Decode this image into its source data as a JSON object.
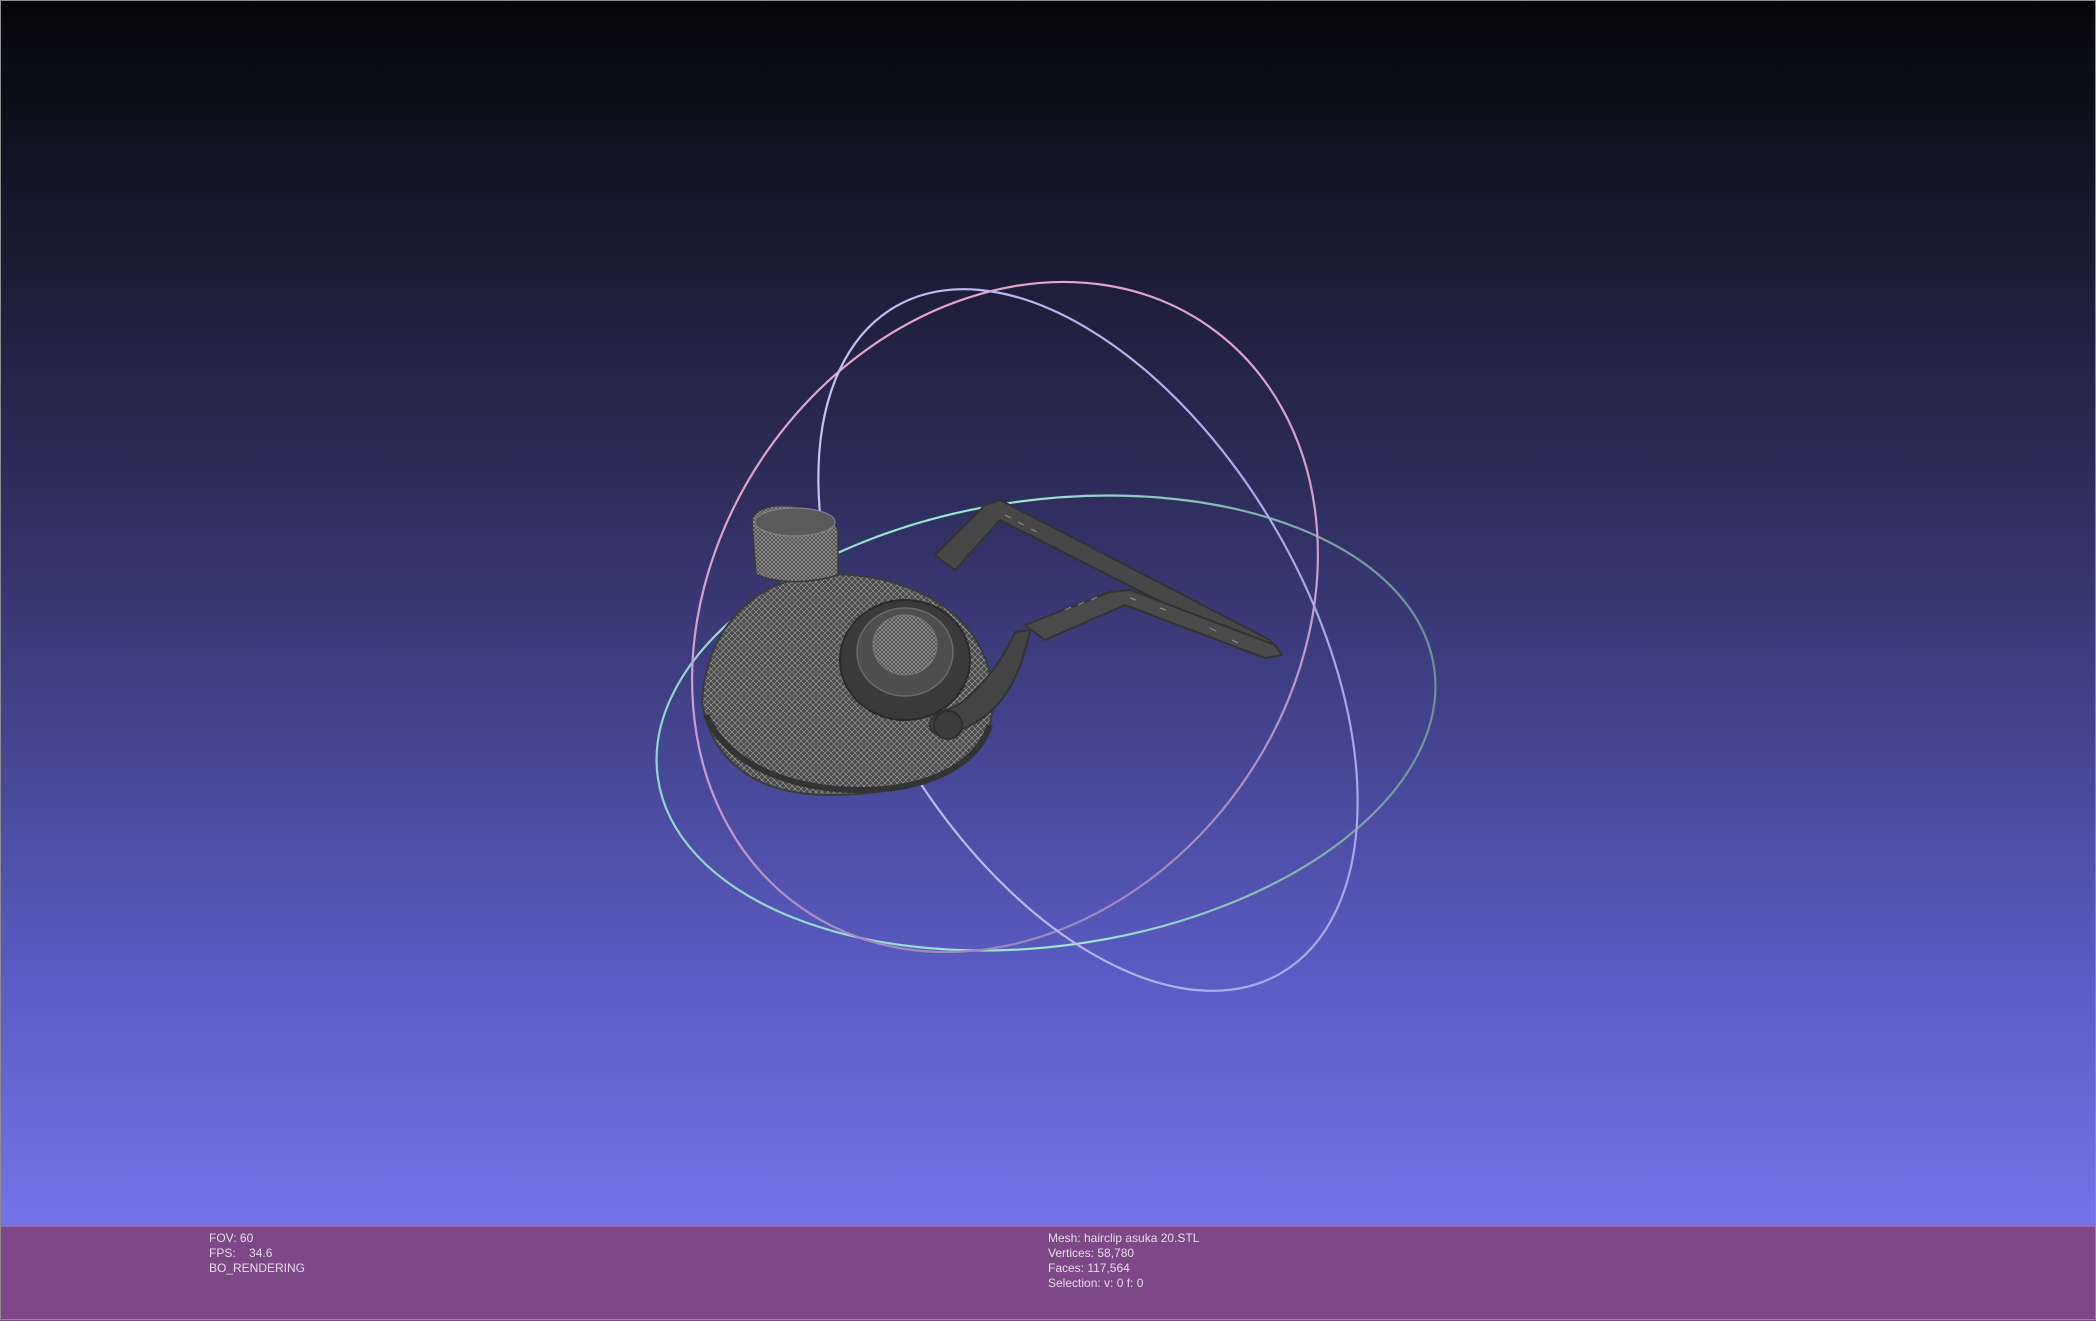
{
  "viewer": {
    "background_top": "#050508",
    "background_bottom": "#7474e8",
    "status_bar_color": "#7e4787",
    "trackball_colors": {
      "horizontal_ring": "#7ed8c8",
      "vertical_ring_a": "#e8a0c8",
      "vertical_ring_b": "#b8b8f0"
    }
  },
  "status_left": {
    "fov": "FOV: 60",
    "fps_label": "FPS:",
    "fps_value": "34.6",
    "render_mode": "BO_RENDERING"
  },
  "status_right": {
    "mesh": "Mesh: hairclip asuka 20.STL",
    "vertices": "Vertices: 58,780",
    "faces": "Faces: 117,564",
    "selection": "Selection: v: 0 f: 0"
  }
}
